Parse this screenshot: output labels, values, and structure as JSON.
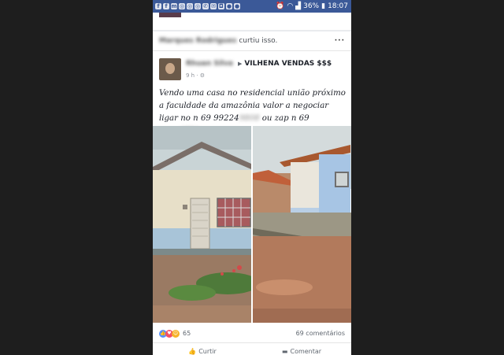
{
  "statusbar": {
    "battery": "36%",
    "time": "18:07",
    "icons": [
      "facebook-icon",
      "facebook-icon",
      "messenger-icon",
      "globe-icon",
      "globe-icon",
      "globe-icon",
      "whatsapp-icon",
      "mail-icon",
      "instagram-icon",
      "chat-icon",
      "chat-icon",
      "alarm-icon",
      "wifi-icon",
      "signal-icon",
      "battery-icon"
    ]
  },
  "activity": {
    "name": "Marques Rodrigues",
    "text": "curtiu isso.",
    "more": "···"
  },
  "post": {
    "author": "Rhuan Silva",
    "group": "VILHENA VENDAS $$$",
    "meta": "9 h · ⚙",
    "text_parts": [
      "Vendo uma casa no residencial união próximo a faculdade da amazônia valor a negociar ligar no n 69 99224",
      "9808",
      " ou zap n 69 9935",
      "6751"
    ]
  },
  "reactions": {
    "count": "65",
    "comments": "69 comentários",
    "colors": {
      "like": "#5890ff",
      "love": "#f25268",
      "haha": "#f7b125"
    }
  },
  "actions": {
    "like": "Curtir",
    "comment": "Comentar"
  }
}
